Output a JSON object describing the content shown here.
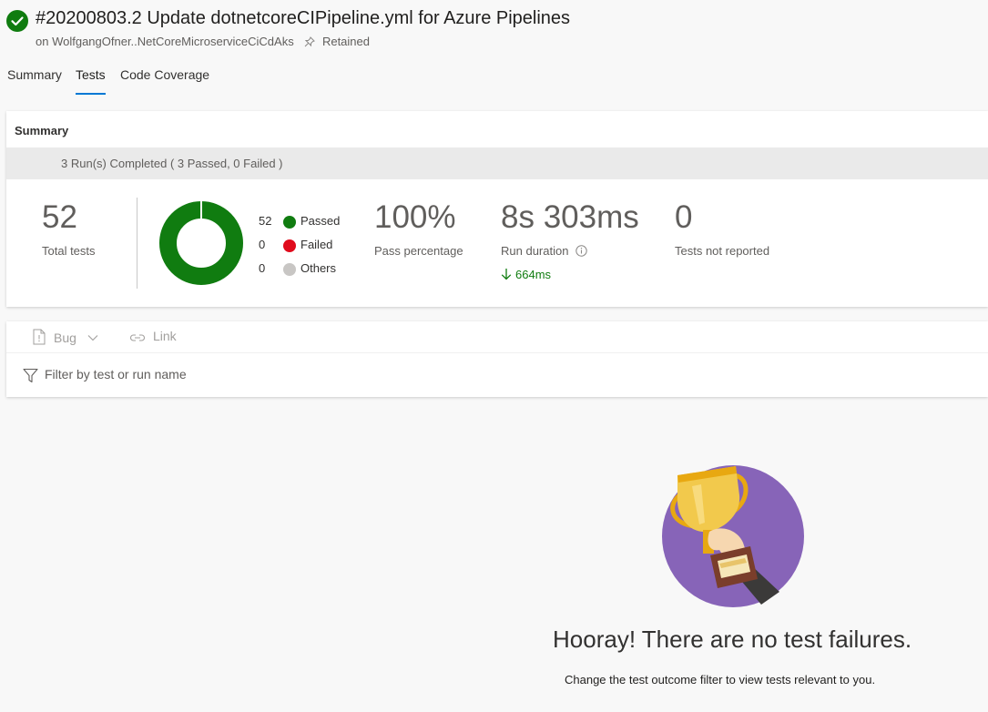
{
  "header": {
    "title": "#20200803.2 Update dotnetcoreCIPipeline.yml for Azure Pipelines",
    "subtitle": "on WolfgangOfner..NetCoreMicroserviceCiCdAks",
    "retained_label": "Retained",
    "status_icon": "check-circle",
    "status_color": "#107c10"
  },
  "tabs": [
    {
      "label": "Summary",
      "active": false
    },
    {
      "label": "Tests",
      "active": true
    },
    {
      "label": "Code Coverage",
      "active": false
    }
  ],
  "summary": {
    "title": "Summary",
    "runs_completed": "3 Run(s) Completed ( 3 Passed, 0 Failed )",
    "total_tests": {
      "value": "52",
      "label": "Total tests"
    },
    "legend": [
      {
        "count": "52",
        "label": "Passed",
        "color": "#107c10"
      },
      {
        "count": "0",
        "label": "Failed",
        "color": "#e00b1c"
      },
      {
        "count": "0",
        "label": "Others",
        "color": "#c8c6c4"
      }
    ],
    "pass_percentage": {
      "value": "100%",
      "label": "Pass percentage"
    },
    "run_duration": {
      "value": "8s 303ms",
      "label": "Run duration",
      "delta": "664ms"
    },
    "not_reported": {
      "value": "0",
      "label": "Tests not reported"
    }
  },
  "toolbar": {
    "bug_label": "Bug",
    "link_label": "Link"
  },
  "filter": {
    "placeholder": "Filter by test or run name"
  },
  "empty_state": {
    "heading": "Hooray! There are no test failures.",
    "hint": "Change the test outcome filter to view tests relevant to you."
  }
}
